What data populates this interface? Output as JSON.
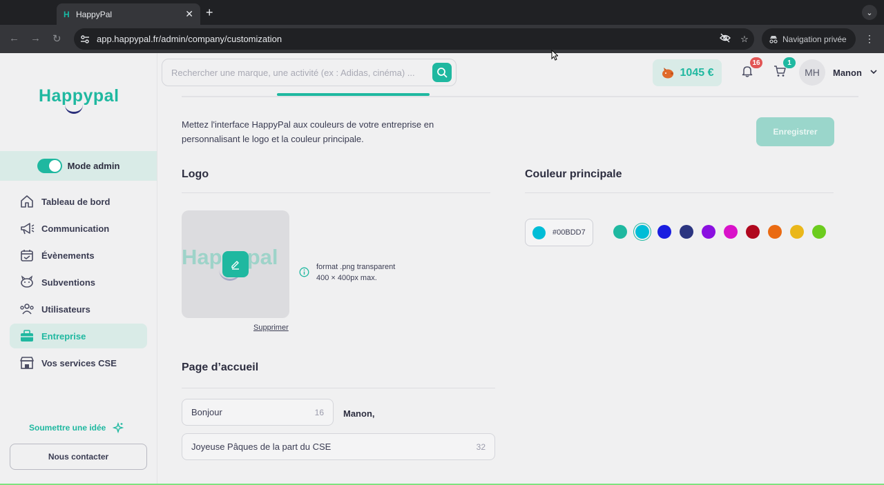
{
  "browser": {
    "tab_favicon": "H",
    "tab_title": "HappyPal",
    "url": "app.happypal.fr/admin/company/customization",
    "private_label": "Navigation privée"
  },
  "sidebar": {
    "logo_text": "Happypal",
    "admin_mode_label": "Mode admin",
    "admin_mode_on": true,
    "items": [
      {
        "label": "Tableau de bord",
        "icon": "home-icon"
      },
      {
        "label": "Communication",
        "icon": "megaphone-icon"
      },
      {
        "label": "Évènements",
        "icon": "calendar-icon"
      },
      {
        "label": "Subventions",
        "icon": "piggy-bank-icon"
      },
      {
        "label": "Utilisateurs",
        "icon": "users-icon"
      },
      {
        "label": "Entreprise",
        "icon": "briefcase-icon",
        "active": true
      },
      {
        "label": "Vos services CSE",
        "icon": "store-icon"
      }
    ],
    "idea_label": "Soumettre une idée",
    "contact_label": "Nous contacter"
  },
  "header": {
    "search_placeholder": "Rechercher une marque, une activité (ex : Adidas, cinéma) ...",
    "balance": "1045 €",
    "notifications_count": "16",
    "cart_count": "1",
    "avatar_initials": "MH",
    "user_name": "Manon"
  },
  "customization": {
    "intro": "Mettez l'interface HappyPal aux couleurs de votre entreprise en personnalisant le logo et la couleur principale.",
    "save_label": "Enregistrer",
    "logo_title": "Logo",
    "logo_preview_text": "Happypal",
    "remove_label": "Supprimer",
    "format_line1": "format .png transparent",
    "format_line2": "400 × 400px max.",
    "color_title": "Couleur principale",
    "selected_color": "#00BDD7",
    "swatches": [
      "#1fb8a0",
      "#00bdd7",
      "#1a1ee0",
      "#2b3580",
      "#8a10e0",
      "#d912c9",
      "#b0071e",
      "#ea6a12",
      "#eab71a",
      "#6ccc1e"
    ],
    "home_title": "Page d’accueil",
    "greeting_value": "Bonjour",
    "greeting_count": "16",
    "greeting_name": "Manon,",
    "message_value": "Joyeuse Pâques de la part du CSE",
    "message_count": "32"
  },
  "colors": {
    "brand": "#1fb8a0",
    "brand_light": "#d9ebe7"
  }
}
